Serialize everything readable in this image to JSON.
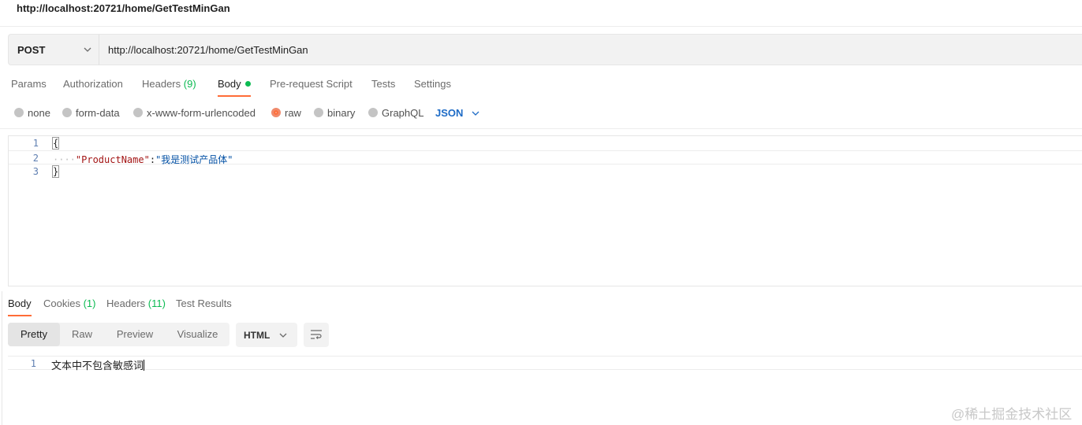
{
  "window": {
    "title": "http://localhost:20721/home/GetTestMinGan"
  },
  "request": {
    "method": "POST",
    "url": "http://localhost:20721/home/GetTestMinGan"
  },
  "request_tabs": [
    {
      "label": "Params"
    },
    {
      "label": "Authorization"
    },
    {
      "label": "Headers",
      "count": "(9)"
    },
    {
      "label": "Body"
    },
    {
      "label": "Pre-request Script"
    },
    {
      "label": "Tests"
    },
    {
      "label": "Settings"
    }
  ],
  "body_types": [
    {
      "label": "none"
    },
    {
      "label": "form-data"
    },
    {
      "label": "x-www-form-urlencoded"
    },
    {
      "label": "raw",
      "selected": true
    },
    {
      "label": "binary"
    },
    {
      "label": "GraphQL"
    }
  ],
  "body_format": "JSON",
  "editor": {
    "lines": [
      {
        "num": "1",
        "text": "{"
      },
      {
        "num": "2",
        "key": "\"ProductName\"",
        "colon": ":",
        "value": "\"我是测试产品体\""
      },
      {
        "num": "3",
        "text": "}"
      }
    ]
  },
  "response_tabs": [
    {
      "label": "Body"
    },
    {
      "label": "Cookies",
      "count": "(1)"
    },
    {
      "label": "Headers",
      "count": "(11)"
    },
    {
      "label": "Test Results"
    }
  ],
  "response_views": [
    "Pretty",
    "Raw",
    "Preview",
    "Visualize"
  ],
  "response_language": "HTML",
  "response_body": {
    "num": "1",
    "text": "文本中不包含敏感词"
  },
  "watermark": "@稀土掘金技术社区",
  "colors": {
    "accent": "#ff6c37",
    "green": "#0cbb52",
    "link_blue": "#1d6bc6"
  },
  "icons": {
    "method_dropdown": "chevron-down-icon",
    "format_dropdown": "chevron-down-icon",
    "wrap": "wrap-lines-icon"
  }
}
